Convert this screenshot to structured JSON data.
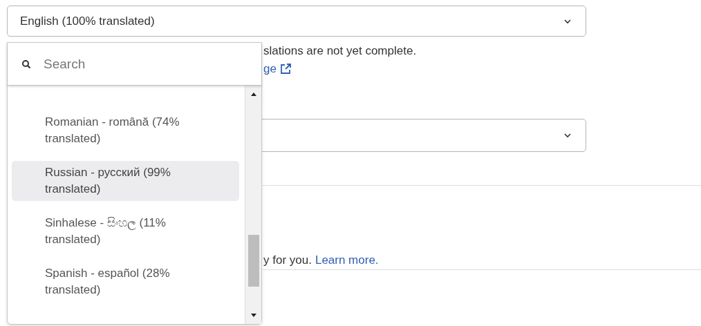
{
  "language_select": {
    "value": "English (100% translated)"
  },
  "notice": {
    "text": "slations are not yet complete.",
    "link": "ge"
  },
  "footer_note": {
    "text": "y for you.",
    "link": "Learn more."
  },
  "dropdown": {
    "search": {
      "placeholder": "Search"
    },
    "options": [
      {
        "label": "Romanian - română (74% translated)",
        "selected": false
      },
      {
        "label": "Russian - русский (99% translated)",
        "selected": true
      },
      {
        "label": "Sinhalese - සිංහල (11% translated)",
        "selected": false
      },
      {
        "label": "Spanish - español (28% translated)",
        "selected": false
      }
    ]
  }
}
